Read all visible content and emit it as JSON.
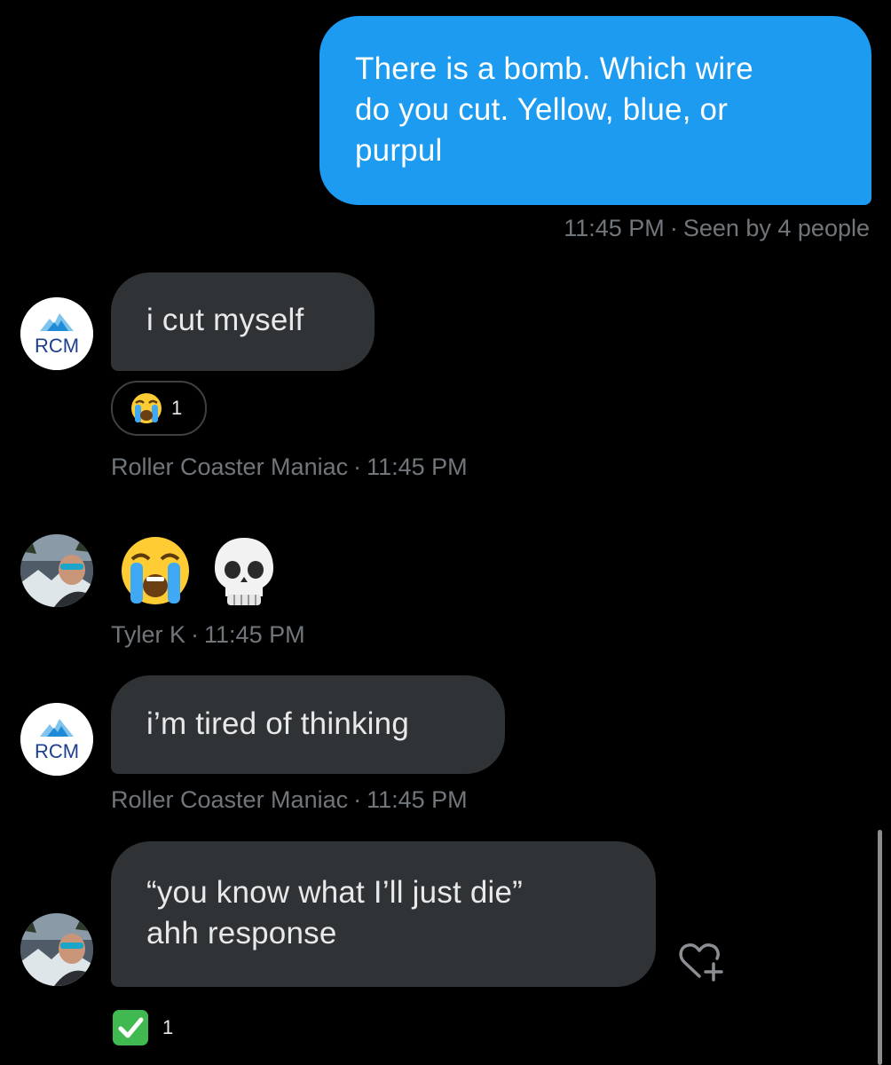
{
  "messages": {
    "outgoing_1": {
      "lines": [
        "There is a bomb. Which wire",
        "do you cut. Yellow, blue, or",
        "purpul"
      ],
      "time": "11:45 PM",
      "separator": "·",
      "seen": "Seen by 4 people"
    },
    "incoming_1": {
      "text": "i cut myself",
      "reaction_count": "1",
      "sender": "Roller Coaster Maniac",
      "separator": "·",
      "time": "11:45 PM"
    },
    "incoming_2": {
      "sender": "Tyler K",
      "separator": "·",
      "time": "11:45 PM"
    },
    "incoming_3": {
      "text": "i’m tired of thinking",
      "sender": "Roller Coaster Maniac",
      "separator": "·",
      "time": "11:45 PM"
    },
    "incoming_4": {
      "lines": [
        "“you know what I’ll just die”",
        "ahh response"
      ],
      "reaction_count": "1"
    }
  },
  "avatars": {
    "rcm_text": "RCM"
  },
  "icons": {
    "sob": "loudly-crying-face-emoji",
    "skull": "skull-emoji",
    "check": "check-mark-button-emoji",
    "react": "heart-plus-icon"
  },
  "colors": {
    "outgoing_bubble": "#1d9bf0",
    "incoming_bubble": "#2f3336",
    "meta_text": "#71767b",
    "background": "#000000"
  }
}
